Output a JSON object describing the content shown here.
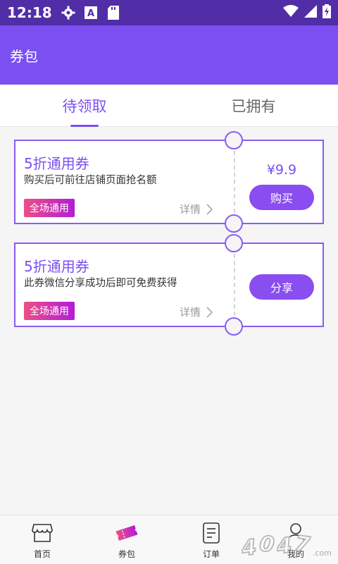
{
  "status_bar": {
    "time": "12:18",
    "icons_left": [
      "gear-icon",
      "font-a-icon",
      "sd-card-icon"
    ],
    "icons_right": [
      "wifi-icon",
      "signal-icon",
      "battery-charging-icon"
    ]
  },
  "app_bar": {
    "title": "券包"
  },
  "tabs": [
    {
      "label": "待领取",
      "active": true
    },
    {
      "label": "已拥有",
      "active": false
    }
  ],
  "coupons": [
    {
      "title": "5折通用券",
      "description": "购买后可前往店铺页面抢名额",
      "tag": "全场通用",
      "detail_label": "详情",
      "price": "¥9.9",
      "button_label": "购买"
    },
    {
      "title": "5折通用券",
      "description": "此券微信分享成功后即可免费获得",
      "tag": "全场通用",
      "detail_label": "详情",
      "button_label": "分享"
    }
  ],
  "bottom_nav": [
    {
      "label": "首页",
      "icon": "store-icon"
    },
    {
      "label": "券包",
      "icon": "ticket-icon"
    },
    {
      "label": "订单",
      "icon": "order-icon"
    },
    {
      "label": "我的",
      "icon": "user-icon"
    }
  ],
  "colors": {
    "primary": "#7B4FF0",
    "status_bar": "#512DA8",
    "tag_start": "#ec4f86",
    "tag_end": "#b41cd6"
  }
}
